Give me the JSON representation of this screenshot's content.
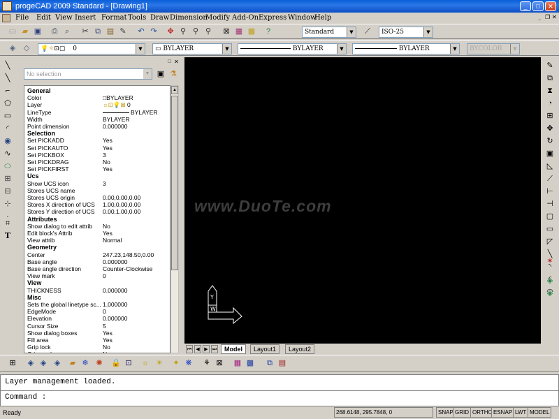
{
  "window": {
    "title": "progeCAD 2009 Standard - [Drawing1]"
  },
  "menu": [
    "File",
    "Edit",
    "View",
    "Insert",
    "Format",
    "Tools",
    "Draw",
    "Dimension",
    "Modify",
    "Add-On",
    "Express",
    "Window",
    "Help"
  ],
  "toolbar": {
    "text_style": "Standard",
    "dim_style": "ISO-25",
    "layer": "0",
    "color": "BYLAYER",
    "linetype": "BYLAYER",
    "lineweight": "BYLAYER",
    "plot_style": "BYCOLOR"
  },
  "properties": {
    "selection": "No selection",
    "rows": [
      {
        "k": "General",
        "v": "",
        "h": true
      },
      {
        "k": "Color",
        "v": "BYLAYER"
      },
      {
        "k": "Layer",
        "v": "0"
      },
      {
        "k": "LineType",
        "v": "BYLAYER"
      },
      {
        "k": "Width",
        "v": "BYLAYER"
      },
      {
        "k": "Point dimension",
        "v": "0.000000"
      },
      {
        "k": "Selection",
        "v": "",
        "h": true
      },
      {
        "k": "Set PICKADD",
        "v": "Yes"
      },
      {
        "k": "Set PICKAUTO",
        "v": "Yes"
      },
      {
        "k": "Set PICKBOX",
        "v": "3"
      },
      {
        "k": "Set PICKDRAG",
        "v": "No"
      },
      {
        "k": "Set PICKFIRST",
        "v": "Yes"
      },
      {
        "k": "Ucs",
        "v": "",
        "h": true
      },
      {
        "k": "Show UCS icon",
        "v": "3"
      },
      {
        "k": "Stores UCS name",
        "v": ""
      },
      {
        "k": "Stores UCS origin",
        "v": "0.00,0.00,0.00"
      },
      {
        "k": "Stores X direction of UCS",
        "v": "1.00,0.00,0.00"
      },
      {
        "k": "Stores Y direction of UCS",
        "v": "0.00,1.00,0.00"
      },
      {
        "k": "Attributes",
        "v": "",
        "h": true
      },
      {
        "k": "Show dialog to edit attrib",
        "v": "No"
      },
      {
        "k": "Edit block's Attrib",
        "v": "Yes"
      },
      {
        "k": "View attrib",
        "v": "Normal"
      },
      {
        "k": "Geometry",
        "v": "",
        "h": true
      },
      {
        "k": "Center",
        "v": "247.23,148.50,0.00"
      },
      {
        "k": "Base angle",
        "v": "0.000000"
      },
      {
        "k": "Base angle direction",
        "v": "Counter-Clockwise"
      },
      {
        "k": "View mark",
        "v": "0"
      },
      {
        "k": "View",
        "v": "",
        "h": true
      },
      {
        "k": "THICKNESS",
        "v": "0.000000"
      },
      {
        "k": "Misc",
        "v": "",
        "h": true
      },
      {
        "k": "Sets the global linetype sc...",
        "v": "1.000000"
      },
      {
        "k": "EdgeMode",
        "v": "0"
      },
      {
        "k": "Elevation",
        "v": "0.000000"
      },
      {
        "k": "Cursor Size",
        "v": "5"
      },
      {
        "k": "Show dialog boxes",
        "v": "Yes"
      },
      {
        "k": "Fill area",
        "v": "Yes"
      },
      {
        "k": "Grip lock",
        "v": "No"
      },
      {
        "k": "Grip mode",
        "v": "No"
      }
    ]
  },
  "canvas": {
    "watermark": "www.DuoTe.com",
    "ucs_y": "Y",
    "ucs_w": "W"
  },
  "tabs": [
    "Model",
    "Layout1",
    "Layout2"
  ],
  "command": {
    "history": "Layer management loaded.",
    "prompt": "Command :"
  },
  "status": {
    "text": "Ready",
    "coords": "268.6148, 295.7848, 0",
    "buttons": [
      "SNAP",
      "GRID",
      "ORTHO",
      "ESNAP",
      "LWT",
      "MODEL"
    ]
  }
}
